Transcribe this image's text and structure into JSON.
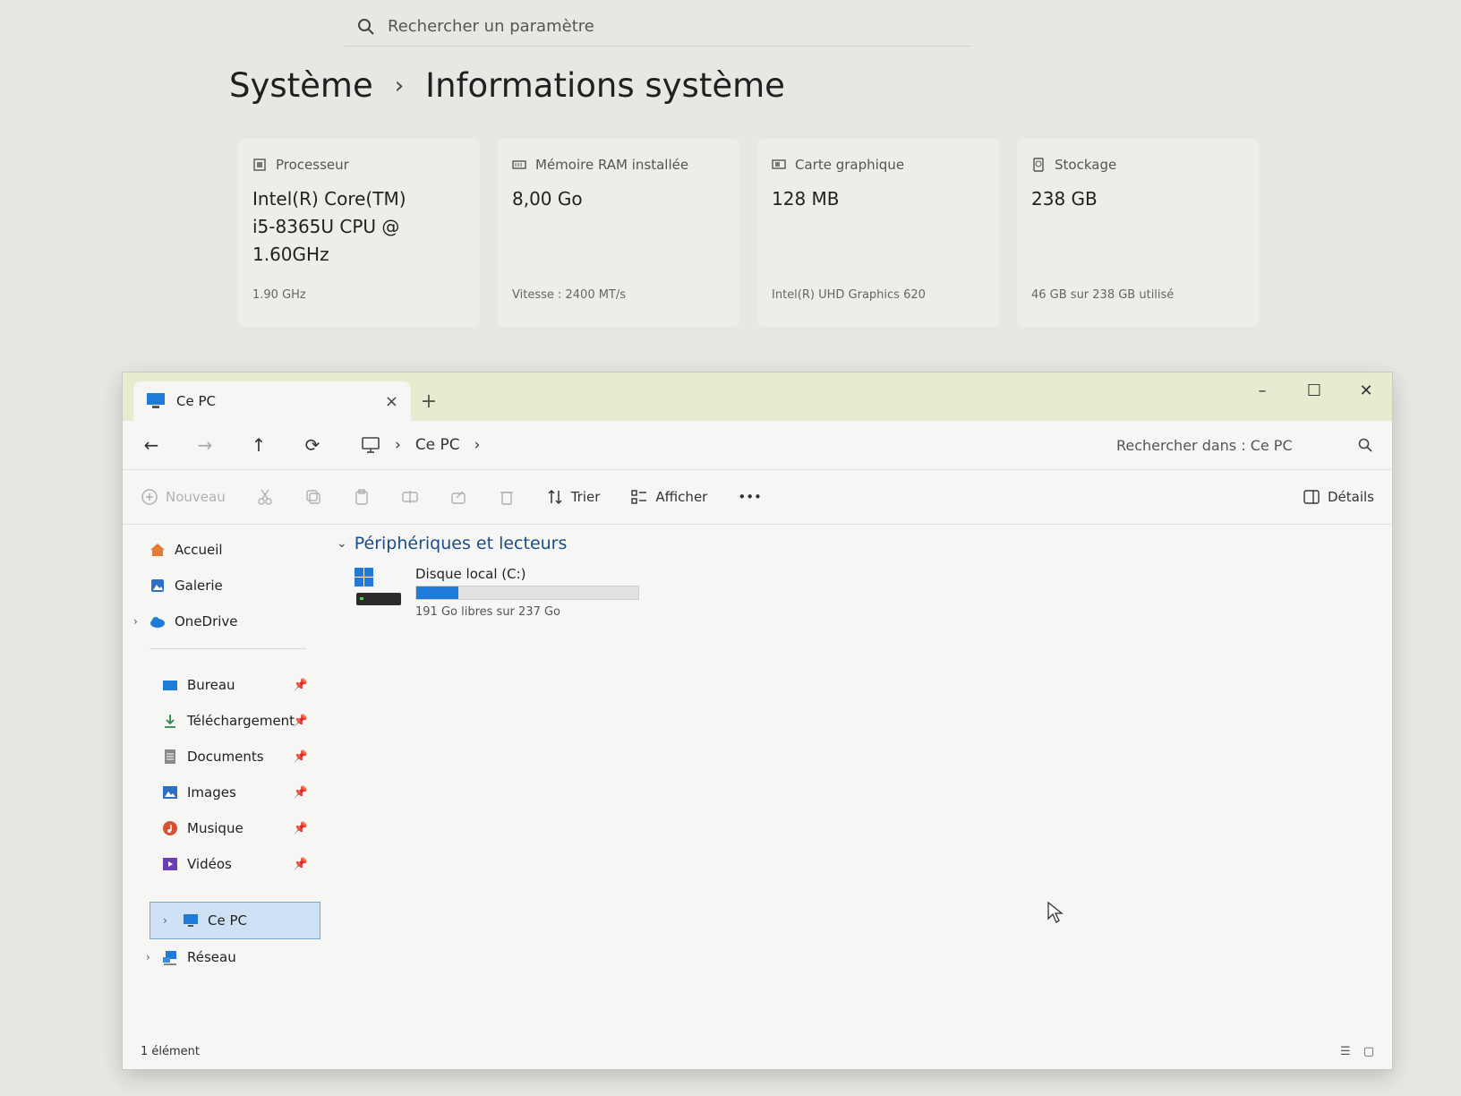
{
  "settings": {
    "search_placeholder": "Rechercher un paramètre",
    "breadcrumb": {
      "parent": "Système",
      "separator": "›",
      "current": "Informations système"
    },
    "cards": [
      {
        "icon": "chip-icon",
        "label": "Processeur",
        "value_lines": [
          "Intel(R) Core(TM)",
          "i5-8365U CPU @",
          "1.60GHz"
        ],
        "sub": "1.90 GHz"
      },
      {
        "icon": "memory-icon",
        "label": "Mémoire RAM installée",
        "value_lines": [
          "8,00 Go"
        ],
        "sub": "Vitesse : 2400 MT/s"
      },
      {
        "icon": "gpu-icon",
        "label": "Carte graphique",
        "value_lines": [
          "128 MB"
        ],
        "sub": "Intel(R) UHD Graphics 620"
      },
      {
        "icon": "storage-icon",
        "label": "Stockage",
        "value_lines": [
          "238 GB"
        ],
        "sub": "46 GB sur 238 GB utilisé"
      }
    ]
  },
  "explorer": {
    "tab": {
      "title": "Ce PC",
      "close": "×",
      "new_tab": "+"
    },
    "window_controls": {
      "minimize": "–",
      "maximize": "☐",
      "close": "✕"
    },
    "nav": {
      "back": "←",
      "forward": "→",
      "up": "↑",
      "refresh": "⟳"
    },
    "path": {
      "sep": "›",
      "location": "Ce PC"
    },
    "search_placeholder": "Rechercher dans : Ce PC",
    "toolbar": {
      "new": "Nouveau",
      "sort": "Trier",
      "view": "Afficher",
      "more": "•••",
      "details": "Détails"
    },
    "sidebar": {
      "top": [
        {
          "label": "Accueil",
          "icon": "home-icon"
        },
        {
          "label": "Galerie",
          "icon": "gallery-icon"
        },
        {
          "label": "OneDrive",
          "icon": "cloud-icon"
        }
      ],
      "quick_access": [
        {
          "label": "Bureau",
          "icon": "desktop-folder-icon"
        },
        {
          "label": "Téléchargement",
          "icon": "download-icon"
        },
        {
          "label": "Documents",
          "icon": "document-icon"
        },
        {
          "label": "Images",
          "icon": "image-icon"
        },
        {
          "label": "Musique",
          "icon": "music-icon"
        },
        {
          "label": "Vidéos",
          "icon": "video-icon"
        }
      ],
      "bottom": [
        {
          "label": "Ce PC",
          "icon": "computer-icon"
        },
        {
          "label": "Réseau",
          "icon": "network-icon"
        }
      ]
    },
    "group": {
      "title": "Périphériques et lecteurs"
    },
    "drive": {
      "name": "Disque local (C:)",
      "free_text": "191 Go libres sur 237 Go",
      "used_fraction": 0.19
    },
    "status": {
      "count": "1 élément"
    }
  },
  "colors": {
    "accent": "#1e7bd8",
    "titlebar": "#e8ebd0",
    "selection": "#cfe2f5"
  }
}
